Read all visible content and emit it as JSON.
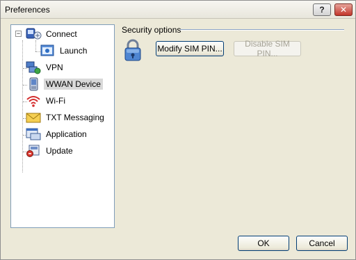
{
  "window": {
    "title": "Preferences",
    "help_label": "?",
    "close_label": "✕"
  },
  "tree": {
    "expander_label": "−",
    "items": [
      {
        "label": "Connect",
        "icon": "connect-icon"
      },
      {
        "label": "Launch",
        "icon": "launch-icon"
      },
      {
        "label": "VPN",
        "icon": "vpn-icon"
      },
      {
        "label": "WWAN Device",
        "icon": "wwan-device-icon",
        "selected": true
      },
      {
        "label": "Wi-Fi",
        "icon": "wifi-icon"
      },
      {
        "label": "TXT Messaging",
        "icon": "txt-messaging-icon"
      },
      {
        "label": "Application",
        "icon": "application-icon"
      },
      {
        "label": "Update",
        "icon": "update-icon"
      }
    ]
  },
  "security": {
    "group_title": "Security options",
    "modify_label": "Modify SIM PIN...",
    "disable_label": "Disable SIM PIN...",
    "disable_enabled": false
  },
  "footer": {
    "ok_label": "OK",
    "cancel_label": "Cancel"
  },
  "colors": {
    "dialog_bg": "#ece9d8",
    "tree_border": "#7f9db9",
    "selected_bg": "#d9d9d9",
    "group_line": "#8aa2c4"
  }
}
